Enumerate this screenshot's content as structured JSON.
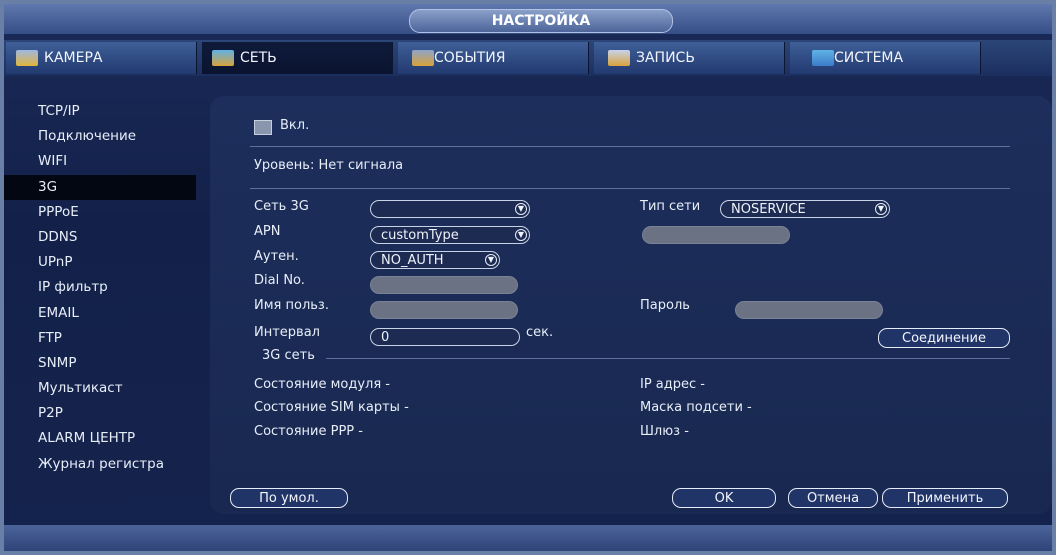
{
  "window_title": "НАСТРОЙКА",
  "tabs": [
    {
      "label": "КАМЕРА",
      "icon": "camera-icon"
    },
    {
      "label": "СЕТЬ",
      "icon": "network-icon"
    },
    {
      "label": "СОБЫТИЯ",
      "icon": "events-icon"
    },
    {
      "label": "ЗАПИСЬ",
      "icon": "record-icon"
    },
    {
      "label": "СИСТЕМА",
      "icon": "system-icon"
    }
  ],
  "active_tab": "СЕТЬ",
  "sidebar": {
    "items": [
      "TCP/IP",
      "Подключение",
      "WIFI",
      "3G",
      "PPPoE",
      "DDNS",
      "UPnP",
      "IP фильтр",
      "EMAIL",
      "FTP",
      "SNMP",
      "Мультикаст",
      "P2P",
      "ALARM ЦЕНТР",
      "Журнал регистра"
    ],
    "active": "3G"
  },
  "form": {
    "enable_label": "Вкл.",
    "level_label": "Уровень:",
    "level_value": "Нет сигнала",
    "net3g_label": "Сеть 3G",
    "net3g_value": "",
    "net_type_label": "Тип сети",
    "net_type_value": "NOSERVICE",
    "apn_label": "APN",
    "apn_value": "customType",
    "auth_label": "Аутен.",
    "auth_value": "NO_AUTH",
    "dial_label": "Dial No.",
    "user_label": "Имя польз.",
    "password_label": "Пароль",
    "interval_label": "Интервал",
    "interval_value": "0",
    "interval_unit": "сек.",
    "connect_label": "Соединение",
    "section_label": "3G сеть",
    "module_state": "Состояние модуля -",
    "sim_state": "Состояние SIM карты -",
    "ppp_state": "Состояние PPP -",
    "ip_address": "IP адрес -",
    "subnet_mask": "Маска подсети -",
    "gateway": "Шлюз -"
  },
  "buttons": {
    "default": "По умол.",
    "ok": "OK",
    "cancel": "Отмена",
    "apply": "Применить"
  }
}
